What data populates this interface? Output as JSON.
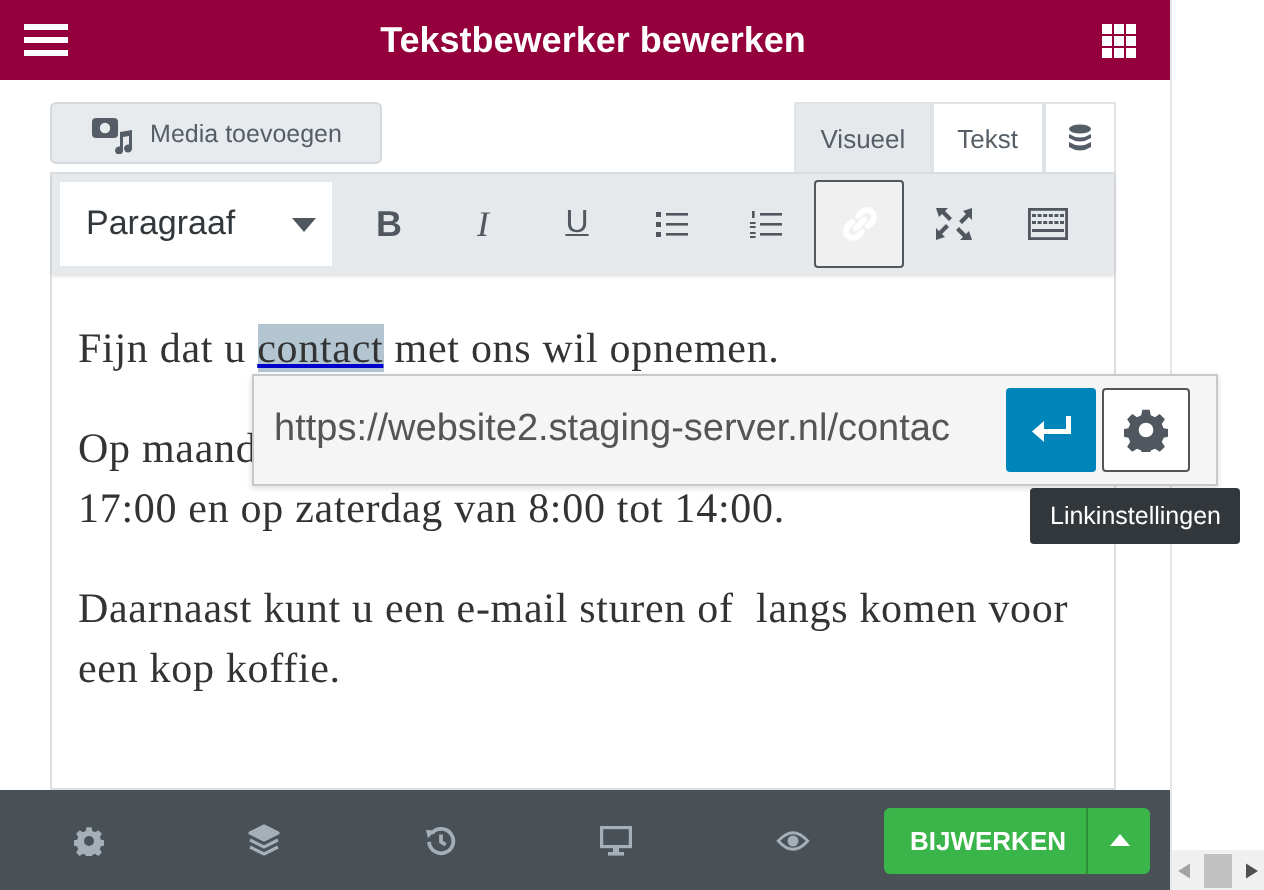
{
  "header": {
    "title": "Tekstbewerker bewerken"
  },
  "media_button": {
    "label": "Media toevoegen"
  },
  "editor_tabs": [
    {
      "label": "Visueel",
      "selected": true
    },
    {
      "label": "Tekst",
      "selected": false
    }
  ],
  "toolbar": {
    "format": "Paragraaf",
    "tools": [
      {
        "kind": "bold",
        "label": "B",
        "active": false
      },
      {
        "kind": "italic",
        "label": "I",
        "active": false
      },
      {
        "kind": "underline",
        "label": "U",
        "active": false
      },
      {
        "kind": "bullet-list",
        "active": false
      },
      {
        "kind": "number-list",
        "active": false
      },
      {
        "kind": "link",
        "active": true
      },
      {
        "kind": "fullscreen",
        "active": false
      },
      {
        "kind": "keyboard",
        "active": false
      }
    ]
  },
  "content": {
    "paragraphs": [
      {
        "lines": [
          [
            {
              "text": "Fijn dat u "
            },
            {
              "text": "contact",
              "link": true,
              "selected": true
            },
            {
              "text": " met ons wil opnemen."
            }
          ]
        ]
      },
      {
        "lines": [
          [
            {
              "text": "Op maand"
            }
          ],
          [
            {
              "text": "17:00 en op zaterdag van 8:00 tot 14:00."
            }
          ]
        ]
      },
      {
        "lines": [
          [
            {
              "text": "Daarnaast kunt u een e-mail sturen of  langs komen voor een kop koffie."
            }
          ]
        ]
      }
    ]
  },
  "link_popup": {
    "url": "https://website2.staging-server.nl/contac",
    "tooltip": "Linkinstellingen"
  },
  "footer": {
    "tools": [
      {
        "kind": "settings"
      },
      {
        "kind": "layers"
      },
      {
        "kind": "history"
      },
      {
        "kind": "monitor"
      },
      {
        "kind": "preview"
      }
    ],
    "update_button": "BIJWERKEN"
  }
}
